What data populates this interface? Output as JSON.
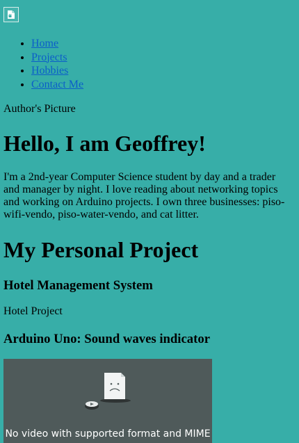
{
  "logo": {
    "icon": "broken-image-icon"
  },
  "nav": {
    "items": [
      {
        "label": "Home"
      },
      {
        "label": "Projects"
      },
      {
        "label": "Hobbies"
      },
      {
        "label": "Contact Me"
      }
    ]
  },
  "author_picture_alt": "Author's Picture",
  "hero": {
    "title": "Hello, I am Geoffrey!",
    "about": "I'm a 2nd-year Computer Science student by day and a trader and manager by night. I love reading about networking topics and working on Arduino projects. I own three businesses: piso-wifi-vendo, piso-water-vendo, and cat litter."
  },
  "projects": {
    "title": "My Personal Project",
    "items": [
      {
        "title": "Hotel Management System",
        "image_alt": "Hotel Project"
      },
      {
        "title": "Arduino Uno: Sound waves indicator"
      }
    ]
  },
  "video": {
    "icon": "sad-file-icon",
    "message": "No video with supported format and MIME type found."
  },
  "colors": {
    "background": "#37aea8",
    "link": "#0b5ec9",
    "video_background": "#4f5a5a"
  }
}
